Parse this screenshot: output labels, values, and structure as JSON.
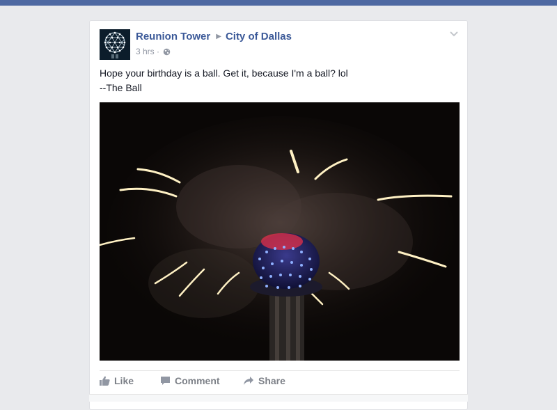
{
  "post": {
    "page_name": "Reunion Tower",
    "target_name": "City of Dallas",
    "timestamp": "3 hrs",
    "privacy_separator": "·",
    "privacy_icon": "globe-icon",
    "text_lines": [
      "Hope your birthday is a ball. Get it, because I'm a ball? lol",
      "--The Ball"
    ]
  },
  "actions": {
    "like_label": "Like",
    "comment_label": "Comment",
    "share_label": "Share"
  },
  "colors": {
    "top_bar": "#4e69a2",
    "link_blue": "#3b5998",
    "background": "#e9eaed",
    "muted": "#9197a3"
  }
}
